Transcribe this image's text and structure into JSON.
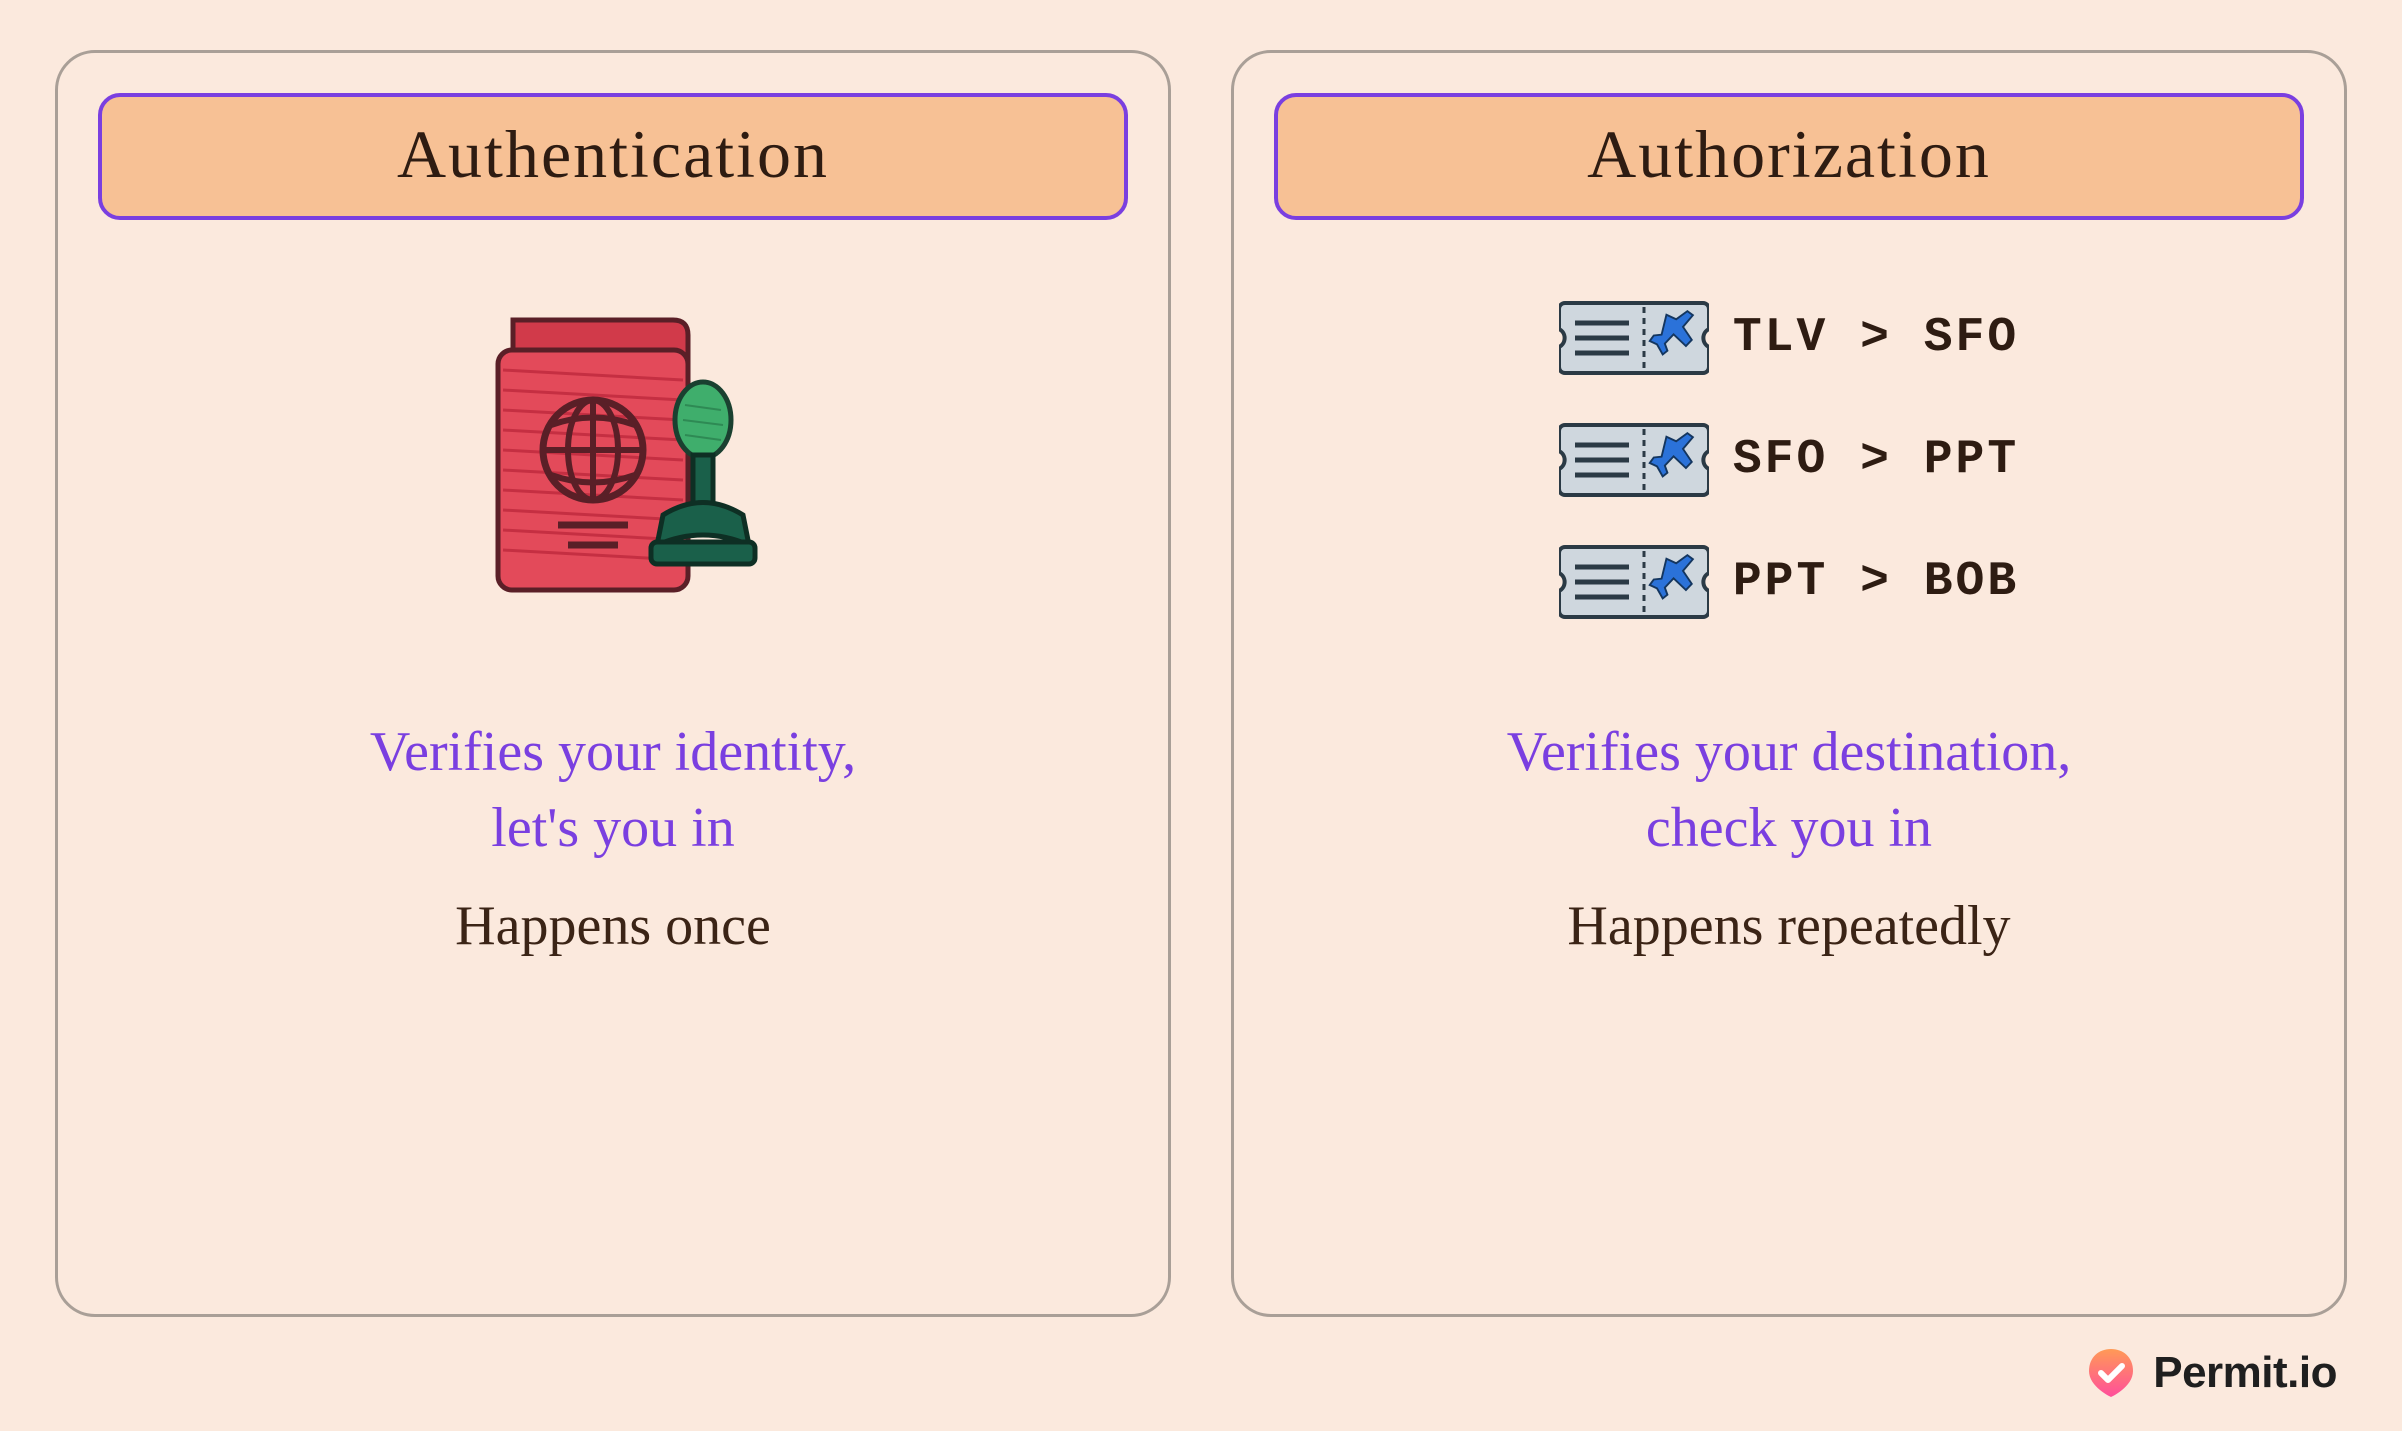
{
  "cards": {
    "left": {
      "title": "Authentication",
      "desc1_line1": "Verifies your identity,",
      "desc1_line2": "let's you in",
      "desc2": "Happens once"
    },
    "right": {
      "title": "Authorization",
      "desc1_line1": "Verifies your destination,",
      "desc1_line2": "check you in",
      "desc2": "Happens repeatedly",
      "routes": [
        {
          "label": "TLV > SFO"
        },
        {
          "label": "SFO > PPT"
        },
        {
          "label": "PPT > BOB"
        }
      ]
    }
  },
  "footer": {
    "brand": "Permit.io"
  },
  "colors": {
    "bg": "#fbe9dd",
    "card_border": "#a99f97",
    "title_bg": "#f7c195",
    "title_border": "#7a3fe0",
    "accent_text": "#7a3fe0",
    "body_text": "#3b2416"
  }
}
